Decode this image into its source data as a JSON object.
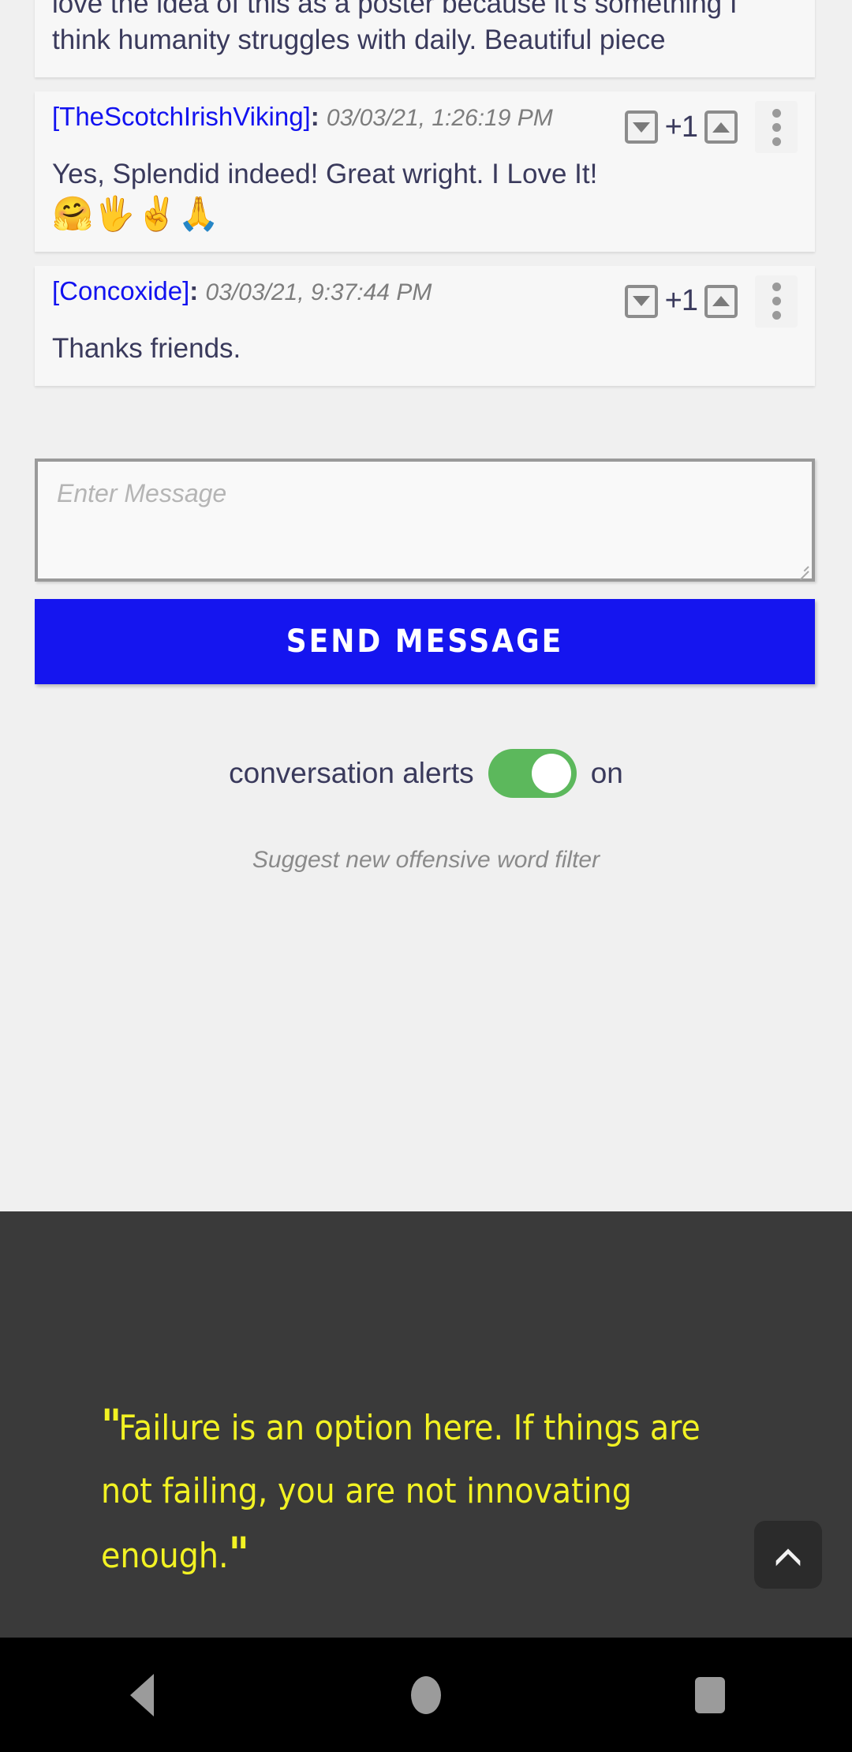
{
  "thread": {
    "comments": [
      {
        "partial": true,
        "username": null,
        "timestamp": null,
        "body": "love the idea of this as a poster because it's something I think humanity struggles with daily. Beautiful piece",
        "emoji": null,
        "score": null
      },
      {
        "partial": false,
        "username": "[TheScotchIrishViking]",
        "colon": ":",
        "timestamp": "03/03/21, 1:26:19 PM",
        "body": "Yes, Splendid indeed! Great wright. I Love It!",
        "emoji": "🤗🖐✌🙏",
        "score": "+1"
      },
      {
        "partial": false,
        "username": "[Concoxide]",
        "colon": ":",
        "timestamp": "03/03/21, 9:37:44 PM",
        "body": "Thanks friends.",
        "emoji": null,
        "score": "+1"
      }
    ],
    "vote": {
      "downvote_icon": "triangle-down-icon",
      "upvote_icon": "triangle-up-icon",
      "menu_icon": "kebab-menu-icon"
    }
  },
  "composer": {
    "placeholder": "Enter Message",
    "value": "",
    "send_label": "SEND MESSAGE",
    "send_color": "#1515ef"
  },
  "settings": {
    "alerts_label": "conversation alerts",
    "alerts_state": "on",
    "alerts_on": true,
    "toggle_color": "#5cb85c",
    "suggest_label": "Suggest new offensive word filter"
  },
  "footer": {
    "open_quote": "\"",
    "quote_text": "Failure is an option here. If things are not failing, you are not innovating enough.",
    "close_quote": "\"",
    "quote_color": "#f2f223",
    "background_color": "#3a3a3a",
    "scroll_top_icon": "chevron-up-icon"
  },
  "navbar": {
    "back_icon": "back-triangle-icon",
    "home_icon": "home-circle-icon",
    "recents_icon": "recents-square-icon"
  }
}
